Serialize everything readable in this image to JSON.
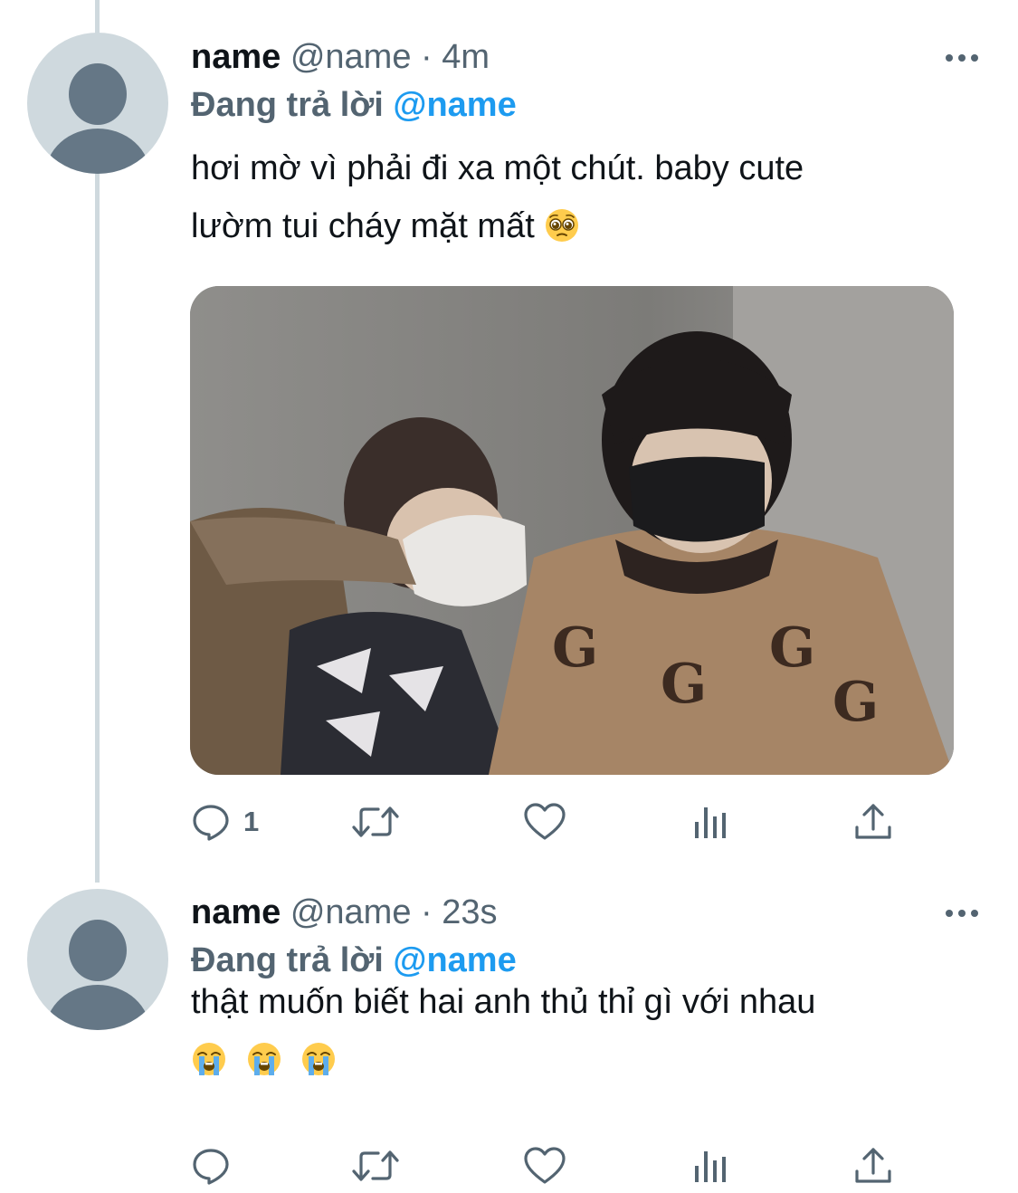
{
  "tweets": [
    {
      "name": "name",
      "handle": "@name",
      "separator": "·",
      "time": "4m",
      "replying_label": "Đang trả lời",
      "replying_to": "@name",
      "text_line_1": "hơi mờ vì phải đi xa một chút. baby cute",
      "text_line_2": "lườm tui cháy mặt mất",
      "emoji": "pleading-face",
      "has_media": true,
      "reply_count": "1"
    },
    {
      "name": "name",
      "handle": "@name",
      "separator": "·",
      "time": "23s",
      "replying_label": "Đang trả lời",
      "replying_to": "@name",
      "text_line_1": "thật muốn biết hai anh thủ thỉ gì với nhau",
      "emoji": "loudly-crying-face",
      "emoji_count": 3,
      "reply_count": ""
    }
  ],
  "icons": {
    "reply": "reply-icon",
    "retweet": "retweet-icon",
    "like": "heart-icon",
    "views": "views-icon",
    "share": "share-icon",
    "more": "more-icon"
  },
  "colors": {
    "text": "#0f1419",
    "secondary": "#536471",
    "accent": "#1d9bf0",
    "avatar_bg": "#cfd9de",
    "avatar_fg": "#657786"
  }
}
